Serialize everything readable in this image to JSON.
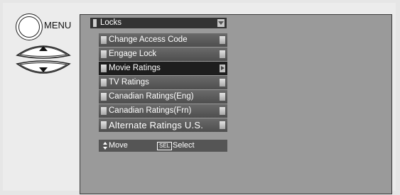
{
  "remote": {
    "menu_label": "MENU"
  },
  "menu": {
    "title": "Locks",
    "items": [
      {
        "label": "Change Access Code",
        "selected": false
      },
      {
        "label": "Engage Lock",
        "selected": false
      },
      {
        "label": "Movie Ratings",
        "selected": true
      },
      {
        "label": "TV Ratings",
        "selected": false
      },
      {
        "label": "Canadian Ratings(Eng)",
        "selected": false
      },
      {
        "label": "Canadian Ratings(Frn)",
        "selected": false
      },
      {
        "label": "Alternate Ratings U.S.",
        "selected": false
      }
    ]
  },
  "help": {
    "move_label": "Move",
    "sel_key": "SEL",
    "select_label": "Select"
  },
  "colors": {
    "screen_bg": "#9a9a9a",
    "item_bg": "#5a5a5a",
    "selected_bg": "#1e1e1e"
  },
  "icons": [
    "menu-button-icon",
    "up-arrow-icon",
    "down-arrow-icon",
    "dropdown-arrow-icon",
    "right-arrow-icon",
    "updown-arrows-icon"
  ]
}
